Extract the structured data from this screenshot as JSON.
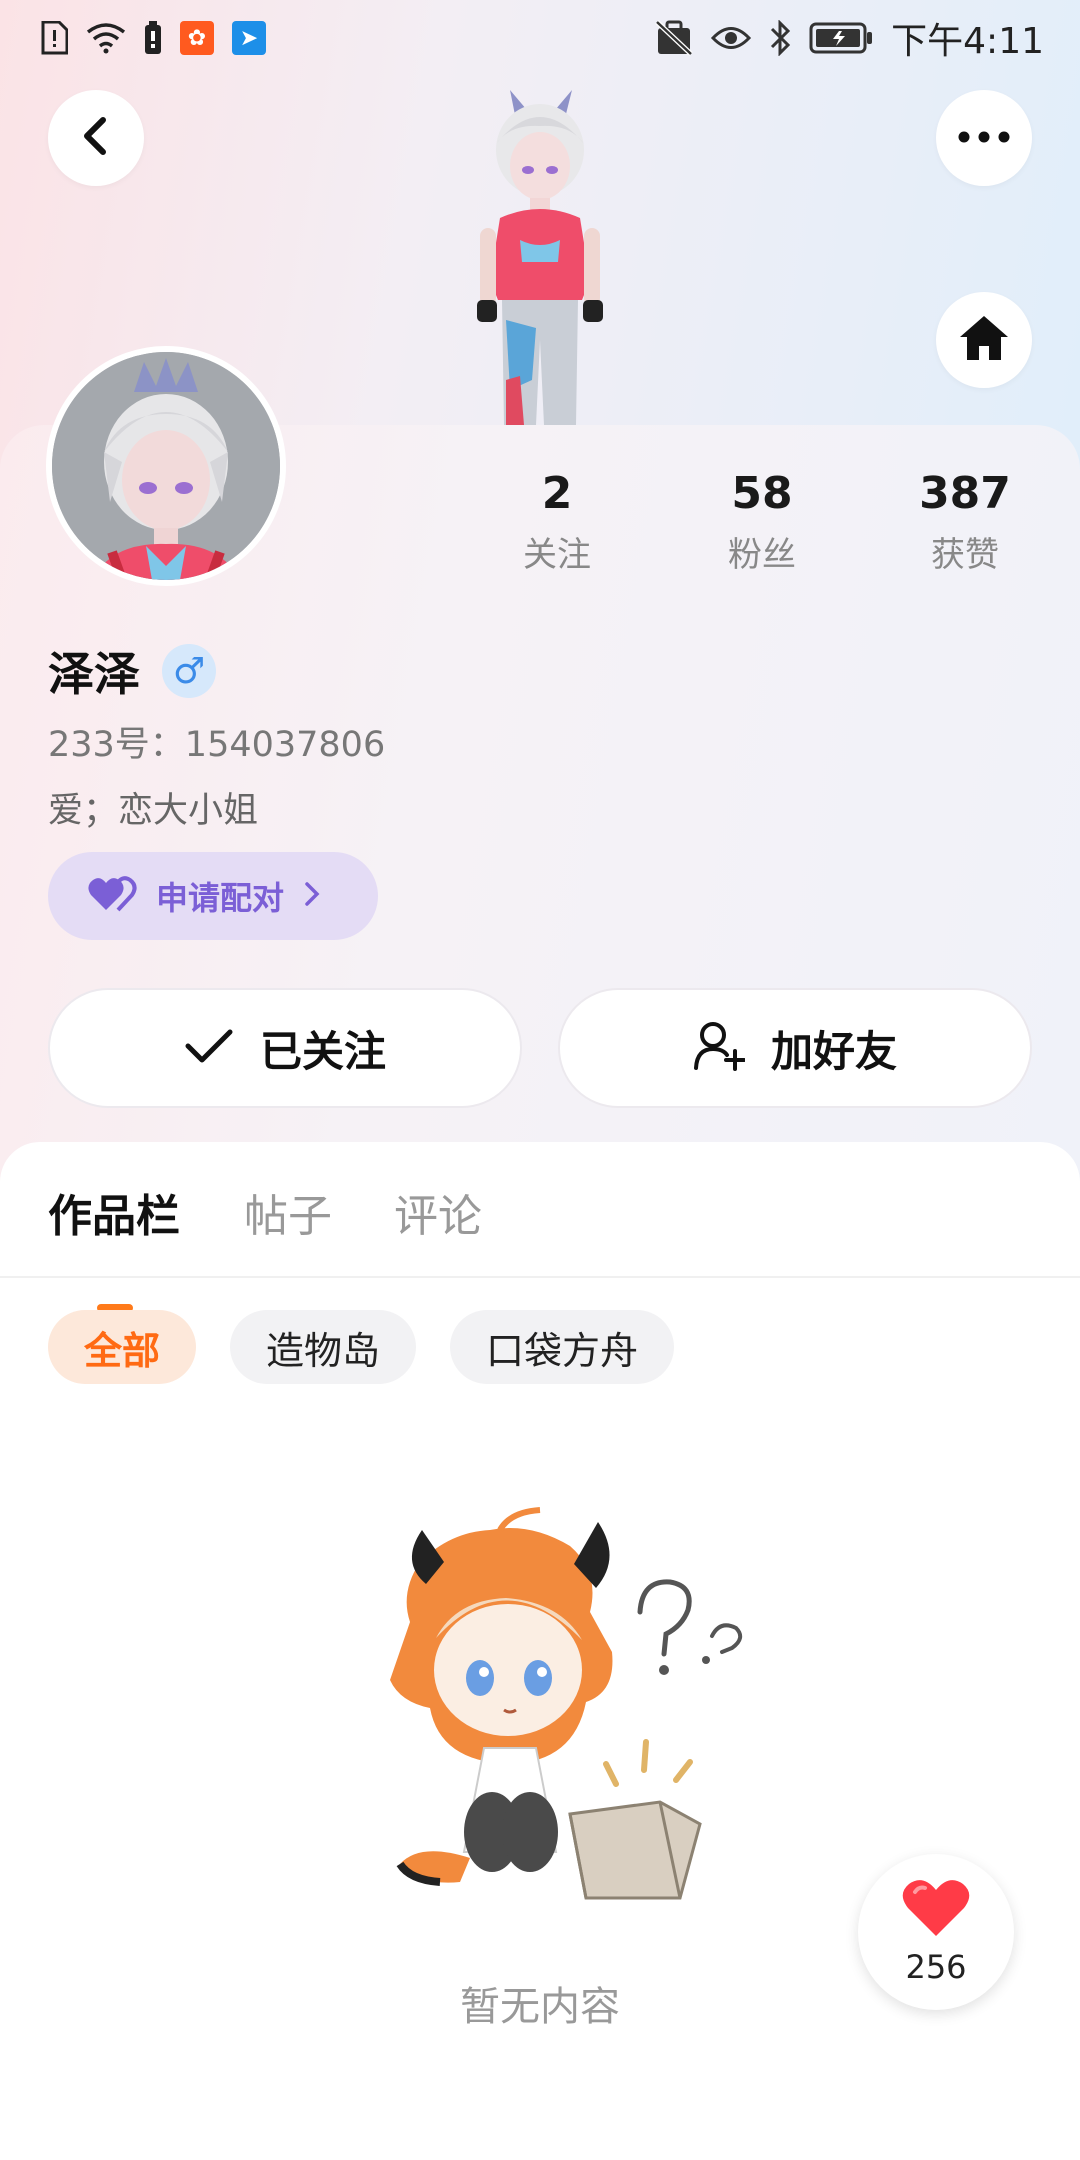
{
  "status_bar": {
    "time": "下午4:11",
    "left_icons": [
      "sim-alert-icon",
      "wifi-icon",
      "battery-saver-icon",
      "app-icon-orange",
      "app-icon-blue"
    ],
    "right_icons": [
      "dnd-icon",
      "eye-icon",
      "bluetooth-icon",
      "battery-icon"
    ]
  },
  "header": {
    "back_icon": "chevron-left-icon",
    "more_icon": "more-dots-icon",
    "home_icon": "home-icon"
  },
  "profile": {
    "stats": [
      {
        "value": "2",
        "label": "关注"
      },
      {
        "value": "58",
        "label": "粉丝"
      },
      {
        "value": "387",
        "label": "获赞"
      }
    ],
    "username": "泽泽",
    "gender_symbol": "♂",
    "account_id": "233号：154037806",
    "bio": "爱；恋大小姐",
    "pair_button": "申请配对",
    "follow_button": "已关注",
    "add_friend_button": "加好友"
  },
  "content": {
    "tabs": [
      "作品栏",
      "帖子",
      "评论"
    ],
    "active_tab": 0,
    "filters": [
      "全部",
      "造物岛",
      "口袋方舟"
    ],
    "active_filter": 0,
    "empty_text": "暂无内容"
  },
  "like_fab": {
    "count": "256"
  },
  "colors": {
    "accent_orange": "#ff6a13",
    "pair_purple": "#7b5fd6",
    "gender_blue": "#3b8be8",
    "like_red": "#ff3b47"
  }
}
